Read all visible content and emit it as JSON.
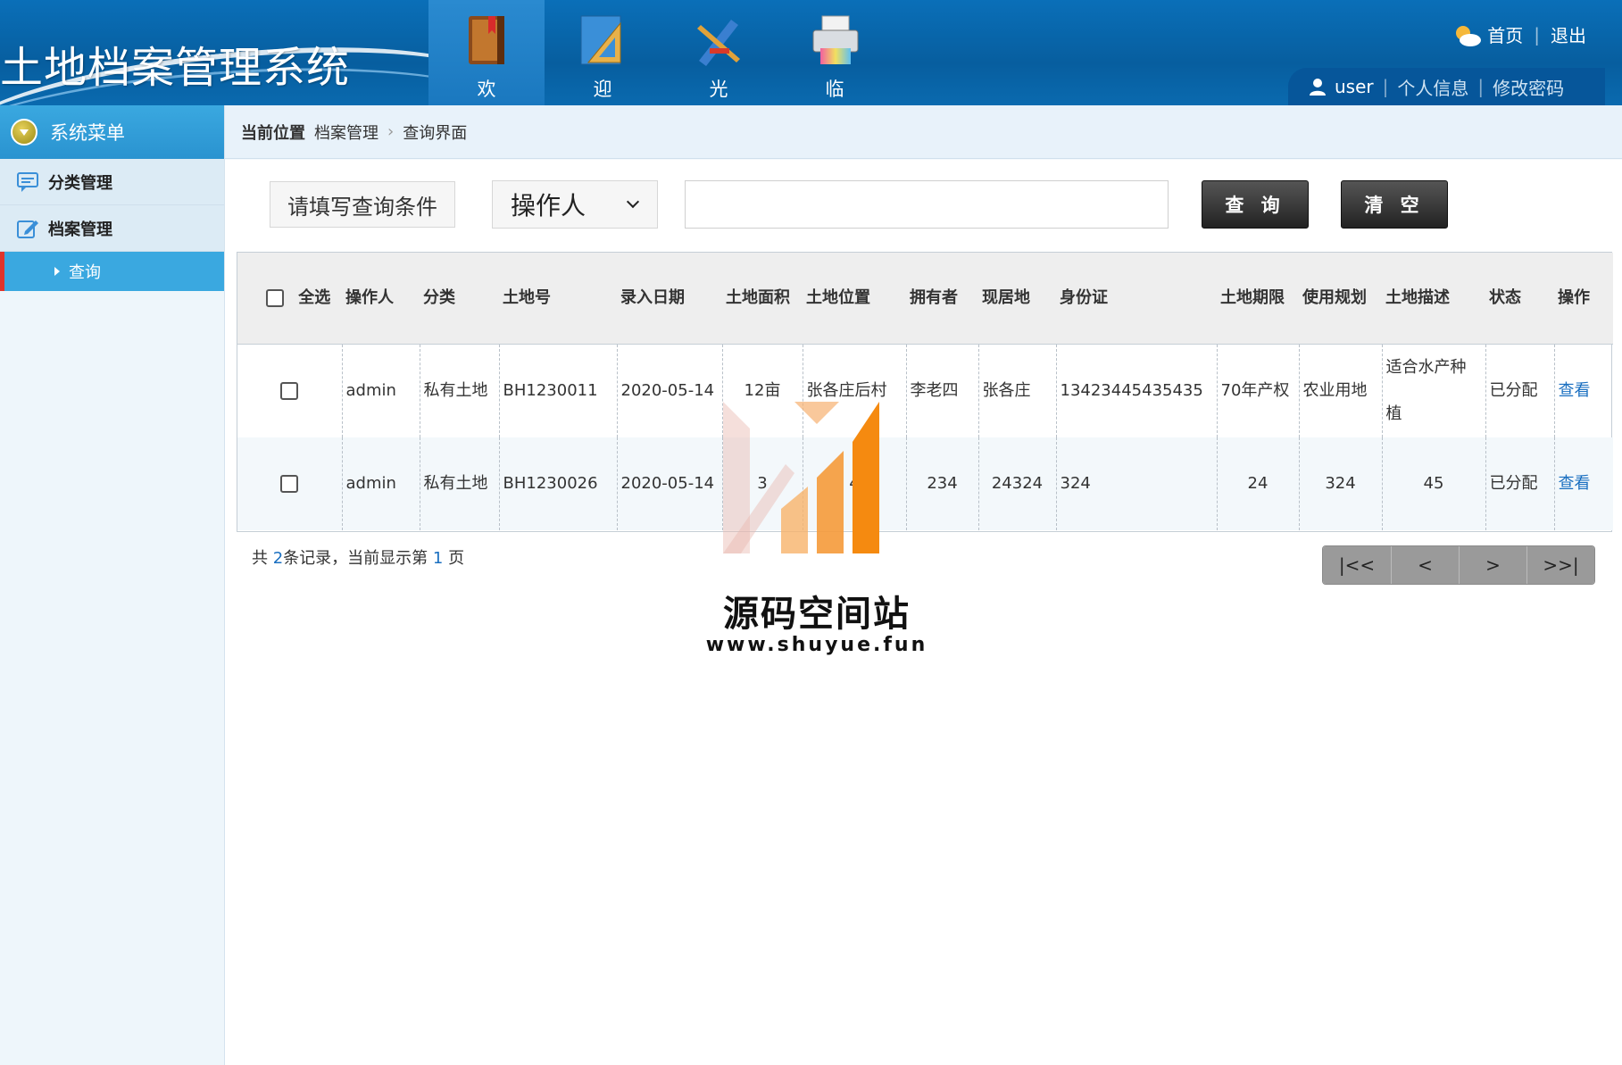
{
  "header": {
    "title": "土地档案管理系统",
    "nav": [
      {
        "label": "欢",
        "icon": "book-icon"
      },
      {
        "label": "迎",
        "icon": "ruler-icon"
      },
      {
        "label": "光",
        "icon": "pen-tools-icon"
      },
      {
        "label": "临",
        "icon": "printer-icon"
      }
    ],
    "home_label": "首页",
    "logout_label": "退出",
    "username": "user",
    "profile_label": "个人信息",
    "change_password_label": "修改密码"
  },
  "sidebar": {
    "title": "系统菜单",
    "items": [
      {
        "label": "分类管理"
      },
      {
        "label": "档案管理"
      }
    ],
    "sub_items": [
      {
        "label": "查询"
      }
    ]
  },
  "breadcrumb": {
    "current_label": "当前位置",
    "path": [
      "档案管理",
      "查询界面"
    ]
  },
  "search": {
    "condition_label": "请填写查询条件",
    "field_select": "操作人",
    "input_value": "",
    "query_button": "查 询",
    "clear_button": "清 空"
  },
  "table": {
    "headers": [
      "全选",
      "操作人",
      "分类",
      "土地号",
      "录入日期",
      "土地面积",
      "土地位置",
      "拥有者",
      "现居地",
      "身份证",
      "土地期限",
      "使用规划",
      "土地描述",
      "状态",
      "操作"
    ],
    "rows": [
      [
        "admin",
        "私有土地",
        "BH1230011",
        "2020-05-14",
        "12亩",
        "张各庄后村",
        "李老四",
        "张各庄",
        "13423445435435",
        "70年产权",
        "农业用地",
        "适合水产种植",
        "已分配",
        "查看"
      ],
      [
        "admin",
        "私有土地",
        "BH1230026",
        "2020-05-14",
        "3",
        "4",
        "234",
        "24324",
        "324",
        "24",
        "324",
        "45",
        "已分配",
        "查看"
      ]
    ]
  },
  "pagination": {
    "prefix": "共 ",
    "total": "2",
    "middle": "条记录，当前显示第 ",
    "page": "1",
    "suffix": " 页",
    "buttons": [
      "|<<",
      "<",
      ">",
      ">>|"
    ]
  },
  "watermark": {
    "text": "源码空间站",
    "url": "www.shuyue.fun"
  },
  "colors": {
    "header_blue": "#0a6fb8",
    "sidebar_active": "#3aa8e0",
    "accent_red": "#e0342b",
    "link_blue": "#1a6fc0"
  }
}
